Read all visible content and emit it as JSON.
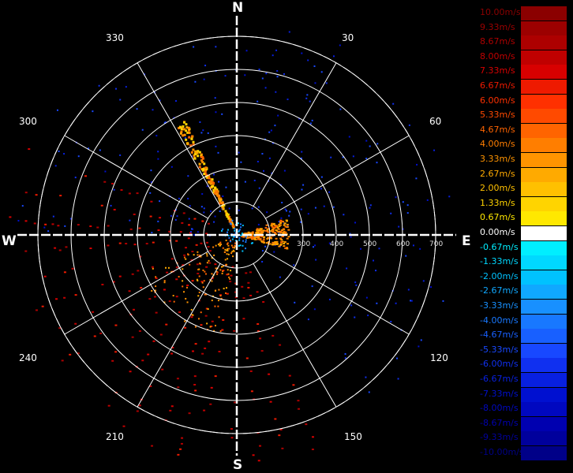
{
  "cardinals": {
    "north": "N",
    "south": "S",
    "east": "E",
    "west": "W"
  },
  "bearings": [
    "30",
    "60",
    "120",
    "150",
    "210",
    "240",
    "300",
    "330"
  ],
  "range_labels": [
    "300",
    "400",
    "500",
    "600",
    "700"
  ],
  "legend": [
    {
      "label": "10.00m/s",
      "color": "#8b0000"
    },
    {
      "label": "9.33m/s",
      "color": "#9c0000"
    },
    {
      "label": "8.67m/s",
      "color": "#ad0000"
    },
    {
      "label": "8.00m/s",
      "color": "#c00000"
    },
    {
      "label": "7.33m/s",
      "color": "#d80000"
    },
    {
      "label": "6.67m/s",
      "color": "#ee1a00"
    },
    {
      "label": "6.00m/s",
      "color": "#ff3000"
    },
    {
      "label": "5.33m/s",
      "color": "#ff4a00"
    },
    {
      "label": "4.67m/s",
      "color": "#ff6400"
    },
    {
      "label": "4.00m/s",
      "color": "#ff7e00"
    },
    {
      "label": "3.33m/s",
      "color": "#ff9400"
    },
    {
      "label": "2.67m/s",
      "color": "#ffaa00"
    },
    {
      "label": "2.00m/s",
      "color": "#ffc000"
    },
    {
      "label": "1.33m/s",
      "color": "#ffd400"
    },
    {
      "label": "0.67m/s",
      "color": "#ffe800"
    },
    {
      "label": "0.00m/s",
      "color": "#ffffff"
    },
    {
      "label": "-0.67m/s",
      "color": "#00eeff"
    },
    {
      "label": "-1.33m/s",
      "color": "#00d8ff"
    },
    {
      "label": "-2.00m/s",
      "color": "#00c2ff"
    },
    {
      "label": "-2.67m/s",
      "color": "#10a8ff"
    },
    {
      "label": "-3.33m/s",
      "color": "#1890ff"
    },
    {
      "label": "-4.00m/s",
      "color": "#1878ff"
    },
    {
      "label": "-4.67m/s",
      "color": "#1860ff"
    },
    {
      "label": "-5.33m/s",
      "color": "#1848ff"
    },
    {
      "label": "-6.00m/s",
      "color": "#1030f0"
    },
    {
      "label": "-6.67m/s",
      "color": "#0820e0"
    },
    {
      "label": "-7.33m/s",
      "color": "#0010d0"
    },
    {
      "label": "-8.00m/s",
      "color": "#0008c0"
    },
    {
      "label": "-8.67m/s",
      "color": "#0000b0"
    },
    {
      "label": "-9.33m/s",
      "color": "#00009c"
    },
    {
      "label": "-10.00m/s",
      "color": "#000088"
    }
  ]
}
